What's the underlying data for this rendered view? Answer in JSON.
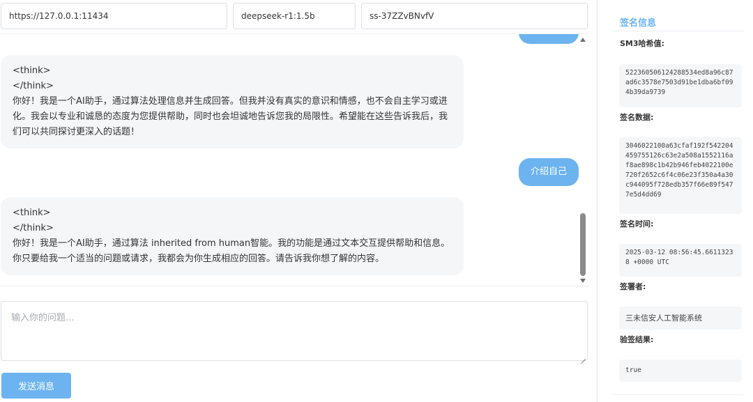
{
  "config": {
    "url": "https://127.0.0.1:11434",
    "model": "deepseek-r1:1.5b",
    "api_key": "ss-37ZZvBNvfV"
  },
  "chat": {
    "messages": [
      {
        "role": "assistant",
        "think_open": "<think>",
        "think_close": "</think>",
        "text": "你好！我是一个AI助手，通过算法处理信息并生成回答。但我并没有真实的意识和情感，也不会自主学习或进化。我会以专业和诚恳的态度为您提供帮助，同时也会坦诚地告诉您我的局限性。希望能在这些告诉我后，我们可以共同探讨更深入的话题！"
      },
      {
        "role": "user",
        "text": "介绍自己"
      },
      {
        "role": "assistant",
        "think_open": "<think>",
        "think_close": "</think>",
        "text": "你好！我是一个AI助手，通过算法 inherited from human智能。我的功能是通过文本交互提供帮助和信息。你只要给我一个适当的问题或请求，我都会为你生成相应的回答。请告诉我你想了解的内容。"
      }
    ]
  },
  "input": {
    "placeholder": "输入你的问题..."
  },
  "send_button": {
    "label": "发送消息"
  },
  "signature": {
    "title": "签名信息",
    "hash_label": "SM3哈希值:",
    "hash_value": "522360506124288534ed8a96c87ad6c3578e7503d91be1dba6bf094b39da9739",
    "data_label": "签名数据:",
    "data_value": "3046022100a63cfaf192f542204459755126c63e2a508a1552116af8ae898c1b42b946feb4022100e720f2652c6f4c06e23f350a4a30c944095f728edb357f66e89f5477e5d4dd69",
    "time_label": "签名时间:",
    "time_value": "2025-03-12 08:56:45.66113238 +0000 UTC",
    "signer_label": "签署者:",
    "signer_value": "三未信安人工智能系统",
    "result_label": "验签结果:",
    "result_value": "true"
  },
  "colors": {
    "accent": "#6cb3ef",
    "bubble_bg": "#f4f6f8",
    "border": "#dcdfe6"
  }
}
